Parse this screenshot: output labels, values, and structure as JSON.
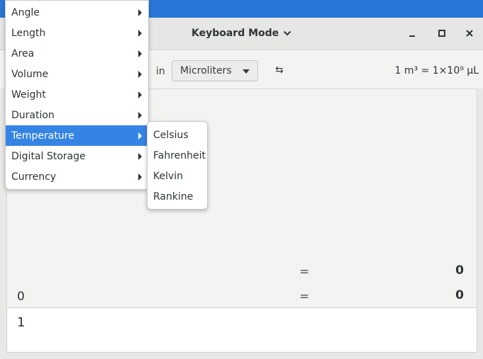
{
  "window": {
    "title": "Keyboard Mode"
  },
  "toolbar": {
    "in_label": "in",
    "unit": "Microliters",
    "swap_symbol": "⇆",
    "ratio": "1 m³ = 1×10⁹ µL"
  },
  "history": [
    {
      "lhs": "",
      "eq": "=",
      "rhs": "0"
    },
    {
      "lhs": "0",
      "eq": "=",
      "rhs": "0"
    }
  ],
  "entry": {
    "value": "1"
  },
  "menu": {
    "items": [
      {
        "label": "Angle"
      },
      {
        "label": "Length"
      },
      {
        "label": "Area"
      },
      {
        "label": "Volume"
      },
      {
        "label": "Weight"
      },
      {
        "label": "Duration"
      },
      {
        "label": "Temperature",
        "active": true
      },
      {
        "label": "Digital Storage"
      },
      {
        "label": "Currency"
      }
    ],
    "submenu": [
      {
        "label": "Celsius"
      },
      {
        "label": "Fahrenheit"
      },
      {
        "label": "Kelvin"
      },
      {
        "label": "Rankine"
      }
    ]
  },
  "colors": {
    "accent": "#3584e4",
    "topbar": "#2a76d6"
  },
  "icons": {
    "title_dropdown": "chevron-down-icon",
    "minimize": "minimize-icon",
    "maximize": "maximize-icon",
    "close": "close-icon"
  }
}
